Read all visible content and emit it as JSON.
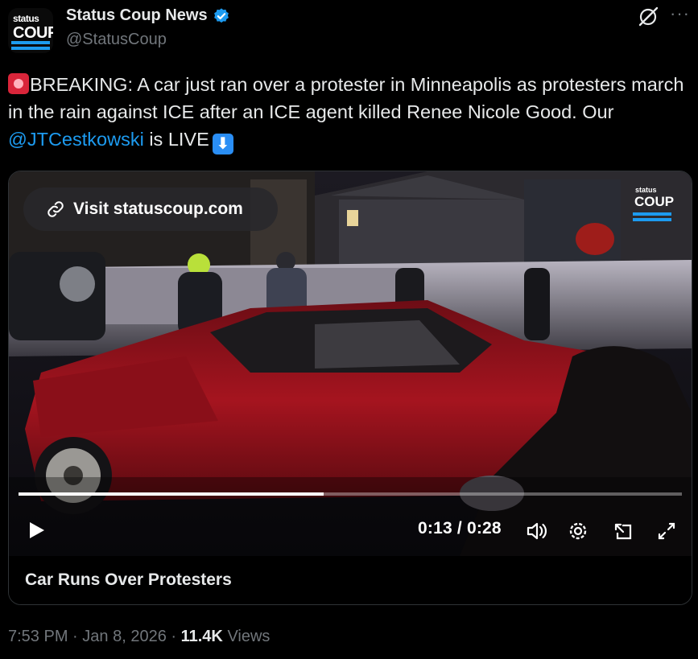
{
  "author": {
    "display_name": "Status Coup News",
    "handle": "@StatusCoup",
    "avatar_text_top": "status",
    "avatar_text_bottom": "COUP",
    "verified": true
  },
  "tweet": {
    "text_before_mention": "BREAKING: A car just ran over a protester in Minneapolis as protesters march in the rain against ICE after an ICE agent killed Renee Nicole Good. Our ",
    "mention": "@JTCestkowski",
    "text_after_mention": " is LIVE",
    "leading_emoji": "siren-emoji",
    "trailing_emoji": "down-arrow-emoji"
  },
  "media": {
    "visit_link_label": "Visit statuscoup.com",
    "watermark_top": "status",
    "watermark_bottom": "COUP",
    "current_time": "0:13",
    "separator": "/",
    "duration": "0:28",
    "progress_fraction": 0.46,
    "caption": "Car Runs Over Protesters"
  },
  "footer": {
    "time": "7:53 PM",
    "dot1": "·",
    "date": "Jan 8, 2026",
    "dot2": "·",
    "views_count": "11.4K",
    "views_label": "Views"
  },
  "colors": {
    "accent": "#1d9bf0",
    "text_primary": "#e7e9ea",
    "text_secondary": "#71767b",
    "background": "#000000",
    "car_red": "#a1131e"
  }
}
